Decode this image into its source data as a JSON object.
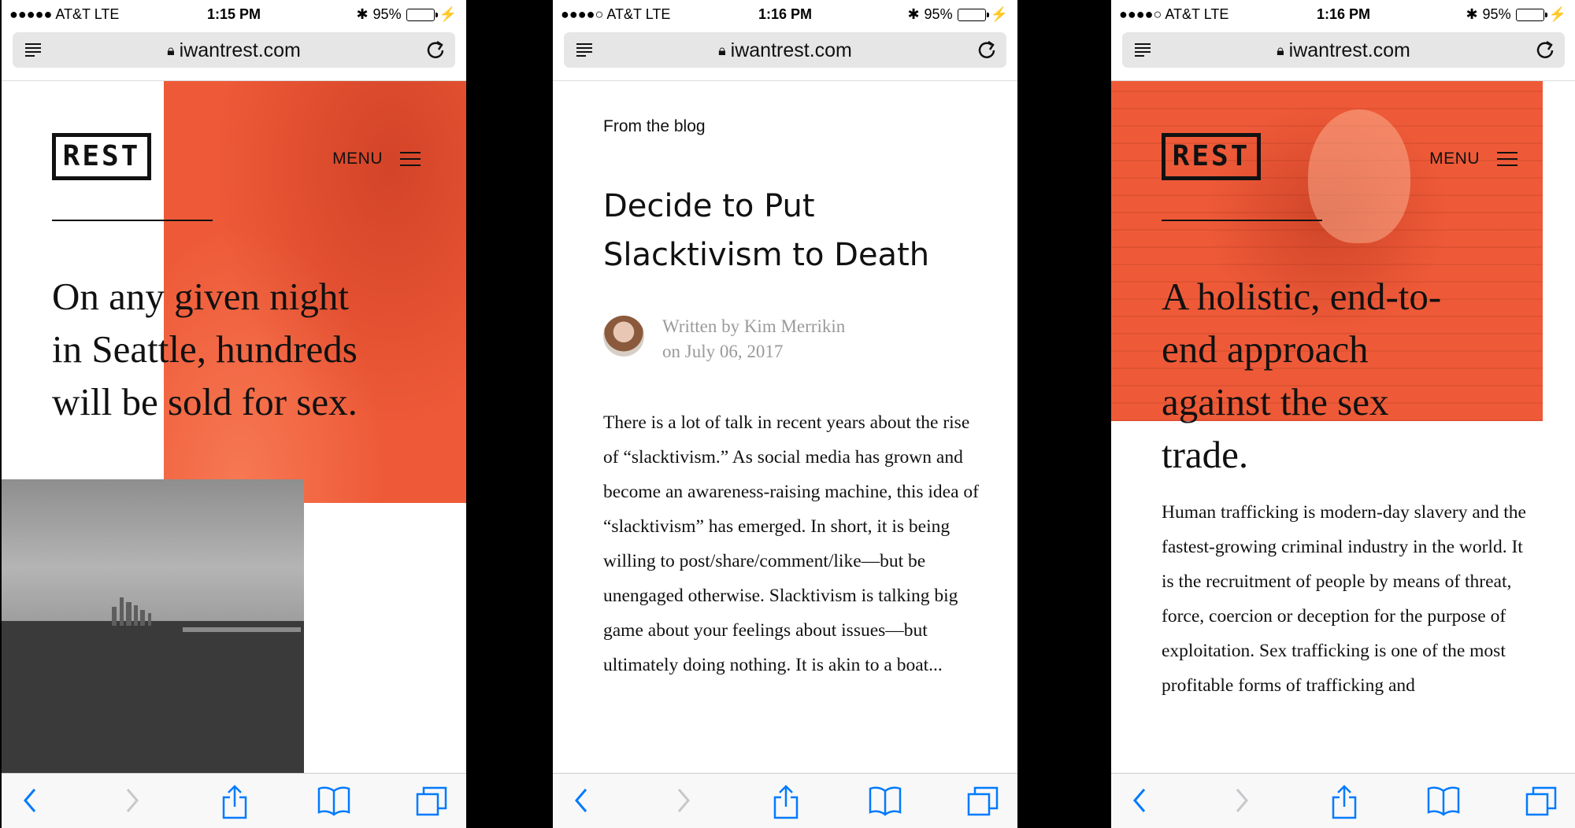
{
  "status": {
    "phone1": {
      "carrier": "AT&T  LTE",
      "time": "1:15 PM",
      "battery": "95%",
      "battery_level": 0.95
    },
    "phone2": {
      "carrier": "AT&T  LTE",
      "time": "1:16 PM",
      "battery": "95%",
      "battery_level": 0.95
    },
    "phone3": {
      "carrier": "AT&T  LTE",
      "time": "1:16 PM",
      "battery": "95%",
      "battery_level": 0.95
    }
  },
  "browser": {
    "url": "iwantrest.com"
  },
  "site": {
    "logo": "REST",
    "menu_label": "MENU"
  },
  "phone1": {
    "headline_lines": [
      "On any given night",
      "in Seattle, hundreds",
      "will be sold for sex."
    ]
  },
  "phone2": {
    "section_label": "From the blog",
    "title_lines": [
      "Decide to Put",
      "Slacktivism to Death"
    ],
    "byline_author": "Written by Kim Merrikin",
    "byline_date": "on July 06, 2017",
    "body": "There is a lot of talk in recent years about the rise of “slacktivism.” As social media has grown and become an awareness-raising machine, this idea of “slacktivism” has emerged. In short, it is being willing to post/share/comment/like—but be unengaged otherwise. Slacktivism is talking big game about your feelings about issues—but ultimately doing nothing. It is akin to a boat..."
  },
  "phone3": {
    "headline_lines": [
      "A holistic, end-to-",
      "end approach",
      "against the sex",
      "trade."
    ],
    "body": "Human trafficking is modern-day slavery and the fastest-growing criminal industry in the world. It is the recruitment of people by means of threat, force, coercion or deception for the purpose of exploitation. Sex trafficking is one of the most profitable forms of trafficking and"
  },
  "colors": {
    "accent": "#ee5a38",
    "battery": "#4cd964",
    "ios_blue": "#007aff"
  },
  "icons": {
    "reader": "reader-mode-icon",
    "lock": "lock-icon",
    "reload": "reload-icon",
    "back": "back-icon",
    "forward": "forward-icon",
    "share": "share-icon",
    "bookmarks": "bookmarks-icon",
    "tabs": "tabs-icon",
    "menu": "hamburger-icon"
  }
}
